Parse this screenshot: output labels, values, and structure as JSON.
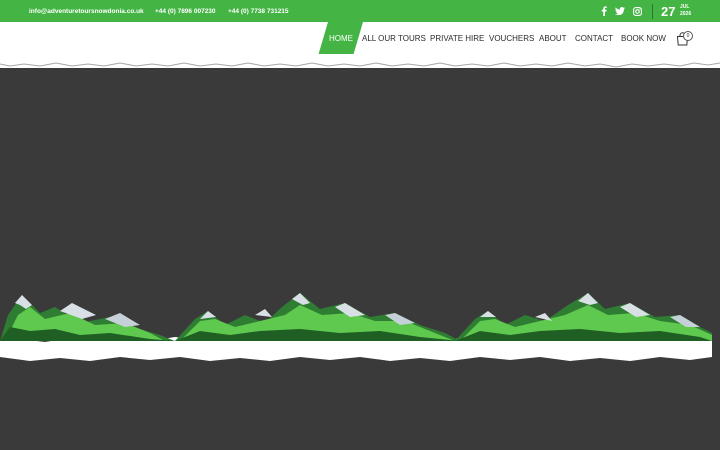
{
  "topbar": {
    "email": "info@adventuretoursnowdonia.co.uk",
    "phone1": "+44 (0) 7896 007230",
    "phone2": "+44 (0) 7738 731215",
    "social": [
      "facebook-icon",
      "twitter-icon",
      "instagram-icon"
    ],
    "date": {
      "day": "27",
      "month": "JUL",
      "year": "2026"
    }
  },
  "nav": {
    "items": [
      "HOME",
      "ALL OUR TOURS",
      "PRIVATE HIRE",
      "VOUCHERS",
      "ABOUT",
      "CONTACT",
      "BOOK NOW"
    ],
    "active": "HOME",
    "cart_count": "0"
  },
  "colors": {
    "brand_green": "#44b544",
    "background": "#3a3a3a",
    "mountain_dark_green": "#2e7d32",
    "mountain_light_green": "#5fc94f",
    "snow": "#d8e0e6"
  }
}
